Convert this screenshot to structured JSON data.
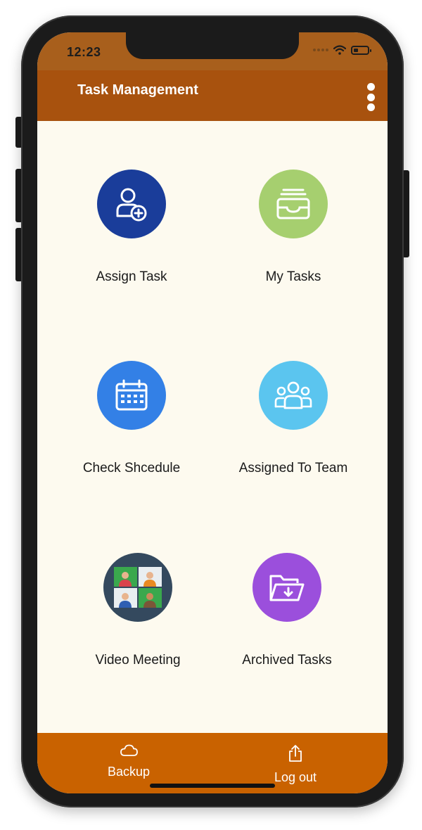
{
  "status_bar": {
    "time": "12:23"
  },
  "app_bar": {
    "title": "Task Management",
    "menu_icon": "more-vertical-icon"
  },
  "tiles": [
    {
      "label": "Assign Task",
      "icon": "add-user-icon",
      "color": "#1a3d9a"
    },
    {
      "label": "My Tasks",
      "icon": "inbox-tray-icon",
      "color": "#a6cf6f"
    },
    {
      "label": "Check Shcedule",
      "icon": "calendar-icon",
      "color": "#3380e6"
    },
    {
      "label": "Assigned To Team",
      "icon": "team-icon",
      "color": "#5bc5ef"
    },
    {
      "label": "Video Meeting",
      "icon": "video-meeting-icon",
      "color": "#34495e"
    },
    {
      "label": "Archived Tasks",
      "icon": "archive-folder-icon",
      "color": "#9b4fdc"
    }
  ],
  "bottom_bar": {
    "backup": {
      "label": "Backup",
      "icon": "cloud-icon"
    },
    "logout": {
      "label": "Log out",
      "icon": "share-icon"
    }
  },
  "colors": {
    "status_bar": "#a85f1c",
    "app_bar": "#a8520e",
    "background": "#fdfaef",
    "bottom_bar": "#c96200"
  }
}
